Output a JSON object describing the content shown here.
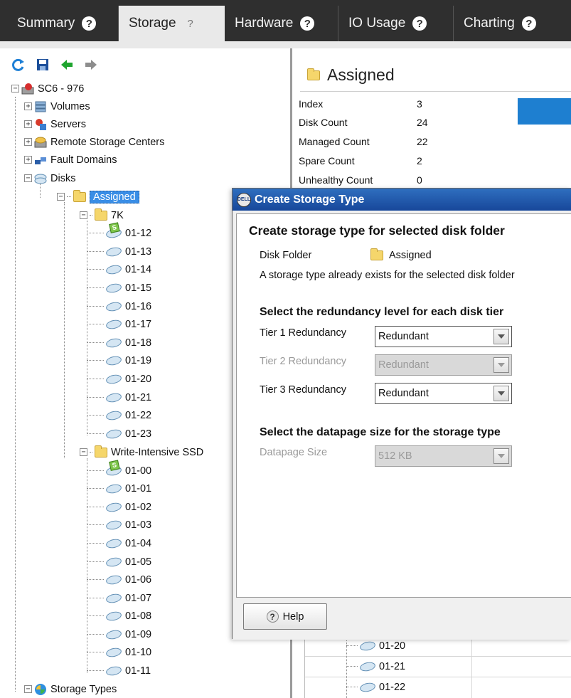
{
  "tabs": [
    {
      "label": "Summary"
    },
    {
      "label": "Storage"
    },
    {
      "label": "Hardware"
    },
    {
      "label": "IO Usage"
    },
    {
      "label": "Charting"
    }
  ],
  "toolbar": {
    "icons": [
      "refresh-icon",
      "save-icon",
      "back-arrow-icon",
      "forward-arrow-icon"
    ]
  },
  "tree": {
    "root": "SC6 - 976",
    "volumes": "Volumes",
    "servers": "Servers",
    "remote": "Remote Storage Centers",
    "fault": "Fault Domains",
    "disks": "Disks",
    "assigned": "Assigned",
    "folder_7k": "7K",
    "disks_7k": [
      "01-12",
      "01-13",
      "01-14",
      "01-15",
      "01-16",
      "01-17",
      "01-18",
      "01-19",
      "01-20",
      "01-21",
      "01-22",
      "01-23"
    ],
    "folder_ssd": "Write-Intensive SSD",
    "disks_ssd": [
      "01-00",
      "01-01",
      "01-02",
      "01-03",
      "01-04",
      "01-05",
      "01-06",
      "01-07",
      "01-08",
      "01-09",
      "01-10",
      "01-11"
    ],
    "storage_types": "Storage Types"
  },
  "details": {
    "title": "Assigned",
    "props": [
      {
        "label": "Index",
        "value": "3"
      },
      {
        "label": "Disk Count",
        "value": "24"
      },
      {
        "label": "Managed Count",
        "value": "22"
      },
      {
        "label": "Spare Count",
        "value": "2"
      },
      {
        "label": "Unhealthy Count",
        "value": "0"
      }
    ],
    "lower_disks": [
      "01-20",
      "01-21",
      "01-22"
    ]
  },
  "dialog": {
    "title": "Create Storage Type",
    "heading": "Create storage type for selected disk folder",
    "disk_folder_label": "Disk Folder",
    "disk_folder_value": "Assigned",
    "info_text": "A storage type already exists for the selected disk folder",
    "redundancy_heading": "Select the redundancy level for each disk tier",
    "tier1_label": "Tier 1 Redundancy",
    "tier1_value": "Redundant",
    "tier2_label": "Tier 2 Redundancy",
    "tier2_value": "Redundant",
    "tier3_label": "Tier 3 Redundancy",
    "tier3_value": "Redundant",
    "datapage_heading": "Select the datapage size for the storage type",
    "datapage_label": "Datapage Size",
    "datapage_value": "512 KB",
    "help_label": "Help",
    "logo_text": "DELL"
  },
  "colors": {
    "tabbar": "#2f2f2f",
    "title_bar": "#17479a",
    "selection": "#3a8ee6",
    "accent_bar": "#1e7fd0"
  }
}
